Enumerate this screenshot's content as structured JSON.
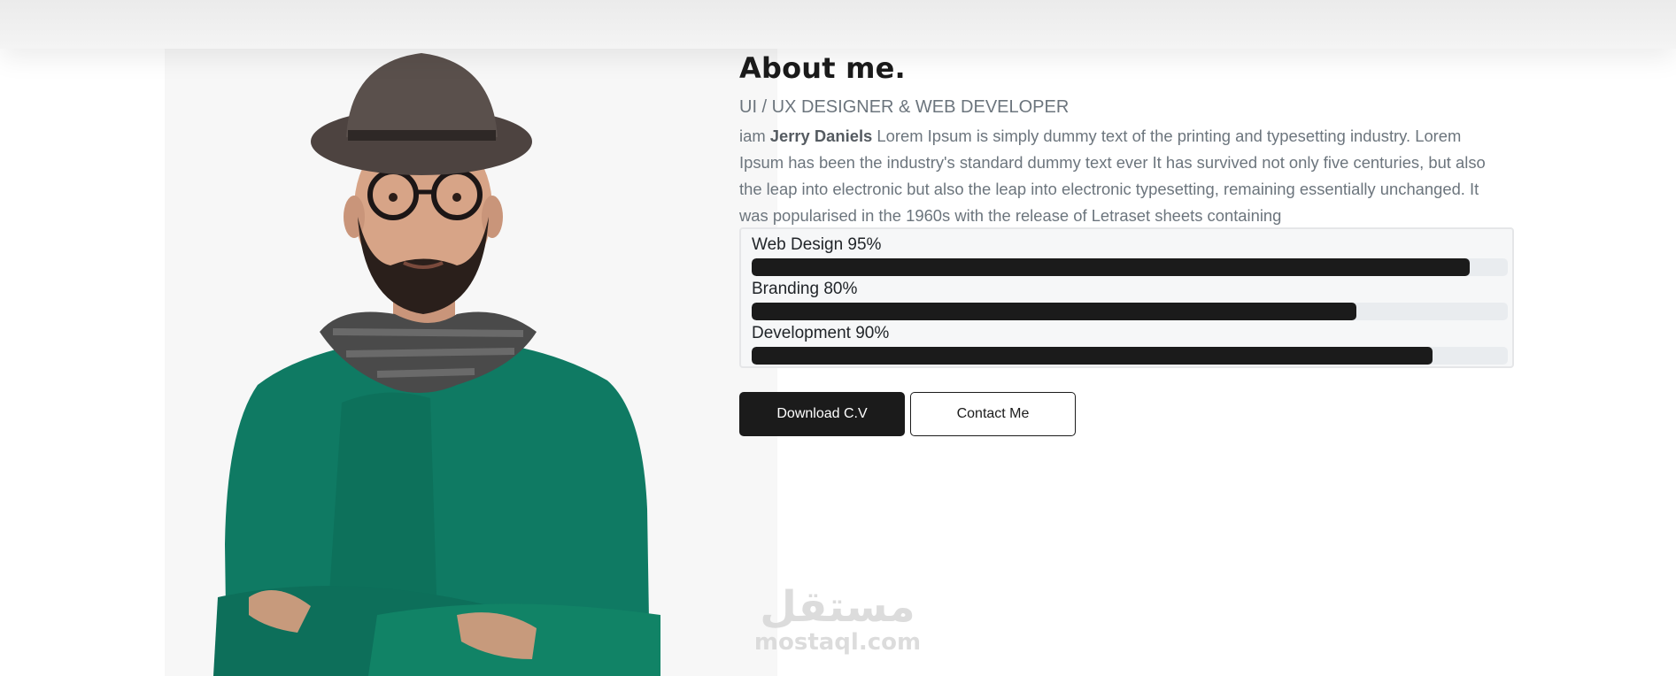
{
  "about": {
    "title": "About me.",
    "subtitle": "UI / UX DESIGNER & WEB DEVELOPER",
    "bio_prefix": "iam ",
    "name": "Jerry Daniels",
    "bio_text": " Lorem Ipsum is simply dummy text of the printing and typesetting industry. Lorem Ipsum has been the industry's standard dummy text ever It has survived not only five centuries, but also the leap into electronic but also the leap into electronic typesetting, remaining essentially unchanged. It was popularised in the 1960s with the release of Letraset sheets containing"
  },
  "skills": [
    {
      "label": "Web Design 95%",
      "percent": 95
    },
    {
      "label": "Branding 80%",
      "percent": 80
    },
    {
      "label": "Development 90%",
      "percent": 90
    }
  ],
  "buttons": {
    "download": "Download C.V",
    "contact": "Contact Me"
  },
  "watermark": {
    "arabic": "مستقل",
    "latin": "mostaql.com"
  },
  "colors": {
    "accent": "#1b1b1b",
    "muted_text": "#6c757d",
    "sweater": "#0f7a63"
  }
}
